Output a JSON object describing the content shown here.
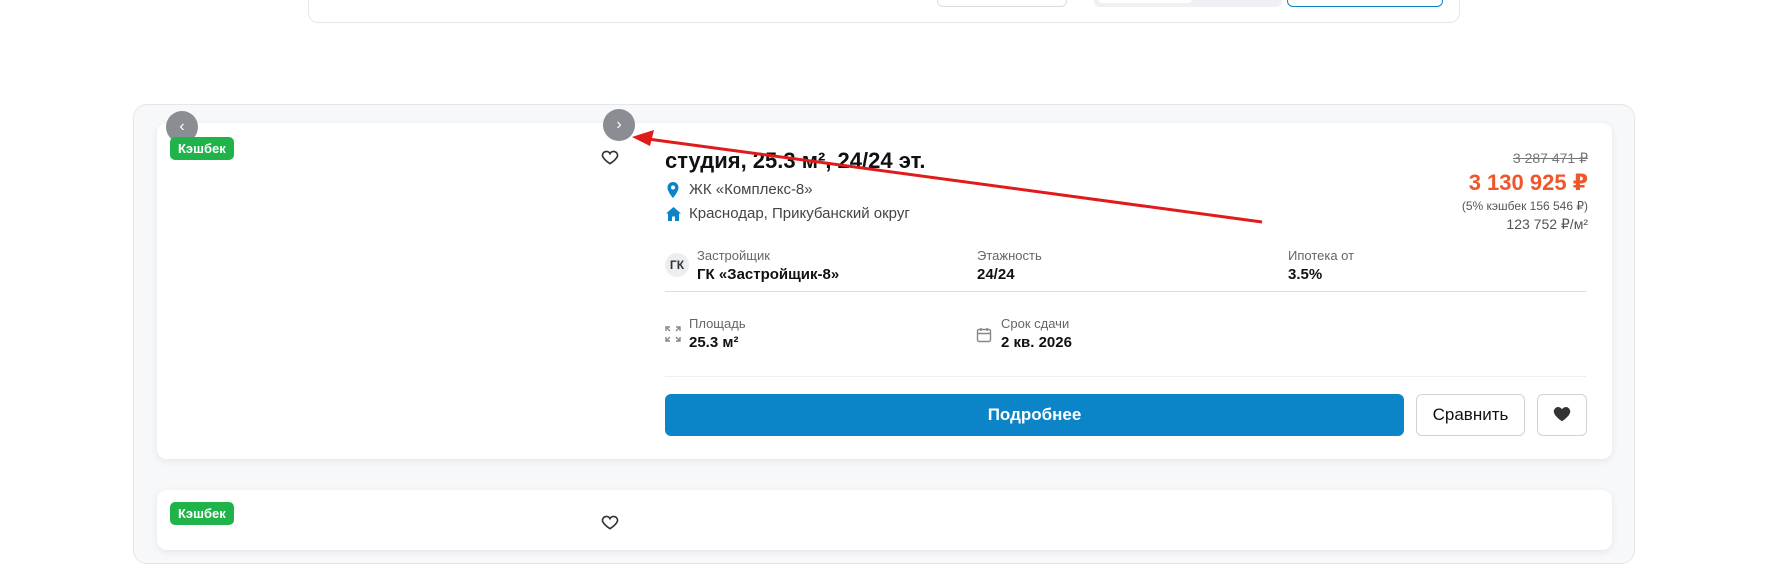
{
  "listing": {
    "badge": "Кэшбек",
    "title": "студия, 25.3 м², 24/24 эт.",
    "complex": "ЖК «Комплекс-8»",
    "address": "Краснодар, Прикубанский округ",
    "price": {
      "old": "3 287 471 ₽",
      "new": "3 130 925 ₽",
      "cashback_note": "(5% кэшбек 156 546 ₽)",
      "per_meter": "123 752 ₽/м²"
    },
    "developer": {
      "avatar_text": "ГК",
      "label": "Застройщик",
      "value": "ГК «Застройщик-8»"
    },
    "floors": {
      "label": "Этажность",
      "value": "24/24"
    },
    "mortgage": {
      "label": "Ипотека от",
      "value": "3.5%"
    },
    "area": {
      "label": "Площадь",
      "value": "25.3 м²"
    },
    "deadline": {
      "label": "Срок сдачи",
      "value": "2 кв. 2026"
    },
    "buttons": {
      "details": "Подробнее",
      "compare": "Сравнить"
    }
  },
  "listing_next": {
    "badge": "Кэшбек"
  },
  "colors": {
    "primary": "#0c84c8",
    "price": "#f0562b",
    "badge": "#20b34a",
    "annotation_arrow": "#e01b1b"
  }
}
